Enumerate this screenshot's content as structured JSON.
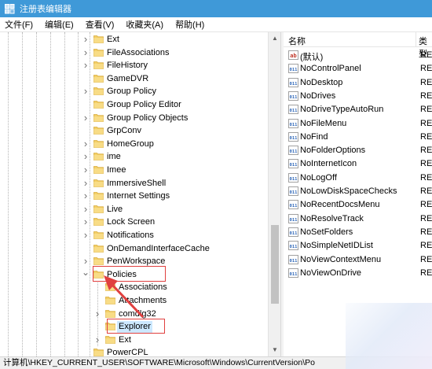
{
  "window": {
    "title": "注册表编辑器"
  },
  "menu": [
    {
      "label": "文件(F)"
    },
    {
      "label": "编辑(E)"
    },
    {
      "label": "查看(V)"
    },
    {
      "label": "收藏夹(A)"
    },
    {
      "label": "帮助(H)"
    }
  ],
  "tree": {
    "items": [
      {
        "label": "Ext",
        "level": 1,
        "expander": "collapsed"
      },
      {
        "label": "FileAssociations",
        "level": 1,
        "expander": "collapsed"
      },
      {
        "label": "FileHistory",
        "level": 1,
        "expander": "collapsed"
      },
      {
        "label": "GameDVR",
        "level": 1,
        "expander": "none"
      },
      {
        "label": "Group Policy",
        "level": 1,
        "expander": "collapsed"
      },
      {
        "label": "Group Policy Editor",
        "level": 1,
        "expander": "none"
      },
      {
        "label": "Group Policy Objects",
        "level": 1,
        "expander": "collapsed"
      },
      {
        "label": "GrpConv",
        "level": 1,
        "expander": "none"
      },
      {
        "label": "HomeGroup",
        "level": 1,
        "expander": "collapsed"
      },
      {
        "label": "ime",
        "level": 1,
        "expander": "collapsed"
      },
      {
        "label": "Imee",
        "level": 1,
        "expander": "collapsed"
      },
      {
        "label": "ImmersiveShell",
        "level": 1,
        "expander": "collapsed"
      },
      {
        "label": "Internet Settings",
        "level": 1,
        "expander": "collapsed"
      },
      {
        "label": "Live",
        "level": 1,
        "expander": "collapsed"
      },
      {
        "label": "Lock Screen",
        "level": 1,
        "expander": "collapsed"
      },
      {
        "label": "Notifications",
        "level": 1,
        "expander": "collapsed"
      },
      {
        "label": "OnDemandInterfaceCache",
        "level": 1,
        "expander": "none"
      },
      {
        "label": "PenWorkspace",
        "level": 1,
        "expander": "collapsed"
      },
      {
        "label": "Policies",
        "level": 1,
        "expander": "expanded"
      },
      {
        "label": "Associations",
        "level": 2,
        "expander": "none"
      },
      {
        "label": "Attachments",
        "level": 2,
        "expander": "none"
      },
      {
        "label": "comdlg32",
        "level": 2,
        "expander": "collapsed"
      },
      {
        "label": "Explorer",
        "level": 2,
        "expander": "none",
        "selected": true
      },
      {
        "label": "Ext",
        "level": 2,
        "expander": "collapsed"
      },
      {
        "label": "PowerCPL",
        "level": 1,
        "expander": "none"
      }
    ]
  },
  "list": {
    "columns": {
      "name": "名称",
      "type": "类型"
    },
    "rows": [
      {
        "name": "(默认)",
        "type": "RE",
        "icon": "string-value-icon"
      },
      {
        "name": "NoControlPanel",
        "type": "RE",
        "icon": "binary-value-icon"
      },
      {
        "name": "NoDesktop",
        "type": "RE",
        "icon": "binary-value-icon"
      },
      {
        "name": "NoDrives",
        "type": "RE",
        "icon": "binary-value-icon"
      },
      {
        "name": "NoDriveTypeAutoRun",
        "type": "RE",
        "icon": "binary-value-icon"
      },
      {
        "name": "NoFileMenu",
        "type": "RE",
        "icon": "binary-value-icon"
      },
      {
        "name": "NoFind",
        "type": "RE",
        "icon": "binary-value-icon"
      },
      {
        "name": "NoFolderOptions",
        "type": "RE",
        "icon": "binary-value-icon"
      },
      {
        "name": "NoInternetIcon",
        "type": "RE",
        "icon": "binary-value-icon"
      },
      {
        "name": "NoLogOff",
        "type": "RE",
        "icon": "binary-value-icon"
      },
      {
        "name": "NoLowDiskSpaceChecks",
        "type": "RE",
        "icon": "binary-value-icon"
      },
      {
        "name": "NoRecentDocsMenu",
        "type": "RE",
        "icon": "binary-value-icon"
      },
      {
        "name": "NoResolveTrack",
        "type": "RE",
        "icon": "binary-value-icon"
      },
      {
        "name": "NoSetFolders",
        "type": "RE",
        "icon": "binary-value-icon"
      },
      {
        "name": "NoSimpleNetIDList",
        "type": "RE",
        "icon": "binary-value-icon"
      },
      {
        "name": "NoViewContextMenu",
        "type": "RE",
        "icon": "binary-value-icon"
      },
      {
        "name": "NoViewOnDrive",
        "type": "RE",
        "icon": "binary-value-icon"
      }
    ]
  },
  "statusbar": {
    "path": "计算机\\HKEY_CURRENT_USER\\SOFTWARE\\Microsoft\\Windows\\CurrentVersion\\Po"
  },
  "colors": {
    "titlebar": "#3f99d8",
    "folder": "#f3cf67",
    "selection": "#cce8ff",
    "annotation_red": "#e0403f"
  }
}
